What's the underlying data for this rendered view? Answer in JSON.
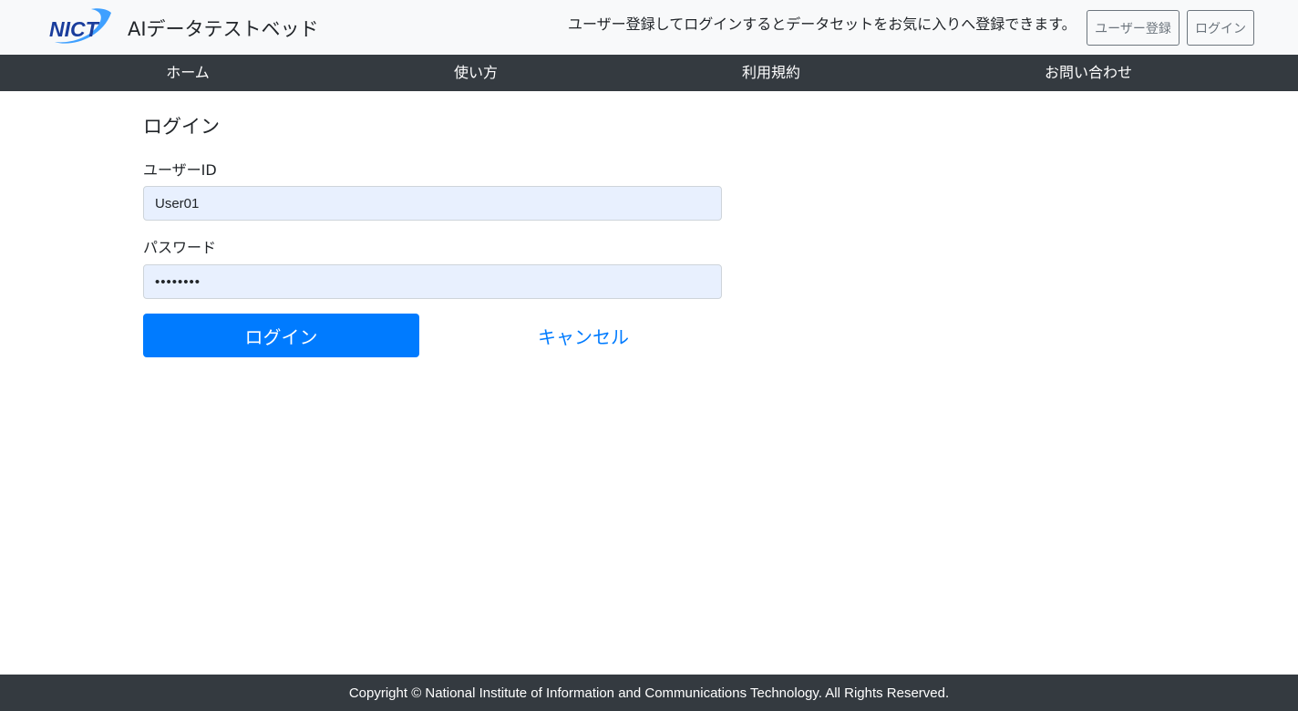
{
  "header": {
    "logo_text": "NICT",
    "site_title": "AIデータテストベッド",
    "register_note": "ユーザー登録してログインするとデータセットをお気に入りへ登録できます。",
    "register_button": "ユーザー登録",
    "login_button": "ログイン"
  },
  "nav": {
    "items": [
      {
        "label": "ホーム"
      },
      {
        "label": "使い方"
      },
      {
        "label": "利用規約"
      },
      {
        "label": "お問い合わせ"
      }
    ]
  },
  "form": {
    "heading": "ログイン",
    "user_label": "ユーザーID",
    "user_value": "User01",
    "password_label": "パスワード",
    "password_value": "••••••••",
    "submit_label": "ログイン",
    "cancel_label": "キャンセル"
  },
  "footer": {
    "copyright": "Copyright © National Institute of Information and Communications Technology. All Rights Reserved."
  },
  "colors": {
    "primary": "#007bff",
    "navbar": "#343a40",
    "topbar": "#f8f9fa",
    "input_autofill": "#e8f0fe",
    "logo_blue": "#1a3d9c",
    "logo_accent": "#1e90ff"
  }
}
